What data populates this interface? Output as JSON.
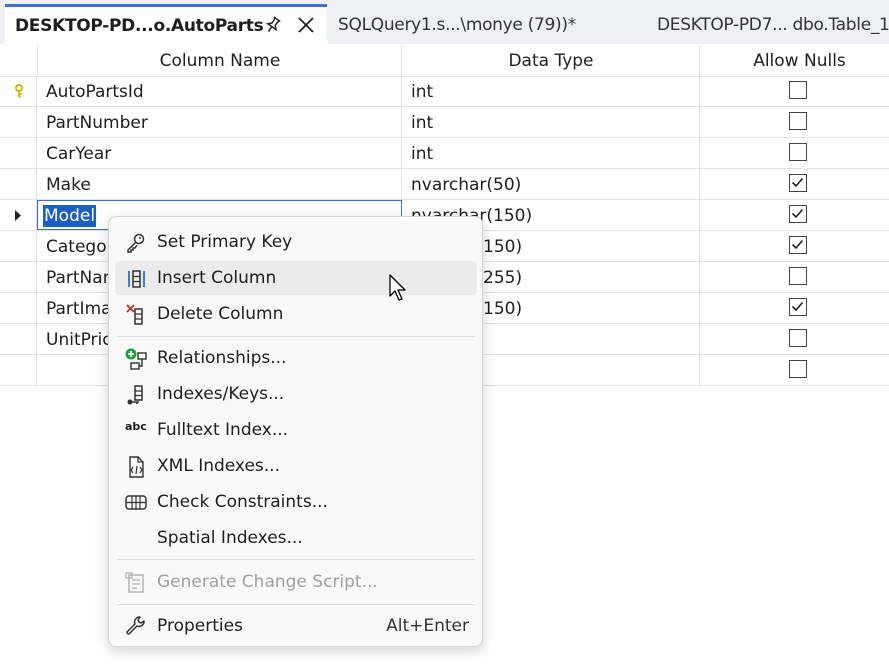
{
  "tabs": [
    {
      "label": "DESKTOP-PD...o.AutoParts",
      "active": true
    },
    {
      "label": "SQLQuery1.s...\\monye (79))*",
      "active": false
    },
    {
      "label": "DESKTOP-PD7... dbo.Table_1",
      "active": false
    }
  ],
  "grid": {
    "headers": {
      "column_name": "Column Name",
      "data_type": "Data Type",
      "allow_nulls": "Allow Nulls"
    },
    "rows": [
      {
        "name": "AutoPartsId",
        "type": "int",
        "nulls": false,
        "key": true
      },
      {
        "name": "PartNumber",
        "type": "int",
        "nulls": false
      },
      {
        "name": "CarYear",
        "type": "int",
        "nulls": false
      },
      {
        "name": "Make",
        "type": "nvarchar(50)",
        "nulls": true
      },
      {
        "name": "Model",
        "type": "nvarchar(150)",
        "nulls": true,
        "editing": true
      },
      {
        "name": "Categor",
        "type": "150)",
        "nulls": true
      },
      {
        "name": "PartNam",
        "type": "255)",
        "nulls": false
      },
      {
        "name": "PartImag",
        "type": "150)",
        "nulls": true
      },
      {
        "name": "UnitPrice",
        "type": "",
        "nulls": false
      },
      {
        "name": "",
        "type": "",
        "nulls": false
      }
    ]
  },
  "context_menu": {
    "items": {
      "set_primary_key": "Set Primary Key",
      "insert_column": "Insert Column",
      "delete_column": "Delete Column",
      "relationships": "Relationships...",
      "indexes_keys": "Indexes/Keys...",
      "fulltext_index": "Fulltext Index...",
      "fulltext_icon_text": "abc",
      "xml_indexes": "XML Indexes...",
      "check_constraints": "Check Constraints...",
      "spatial_indexes": "Spatial Indexes...",
      "generate_change_script": "Generate Change Script...",
      "properties": "Properties",
      "properties_shortcut": "Alt+Enter"
    }
  },
  "colors": {
    "accent": "#3b6fd8",
    "selection": "#1a5fc8",
    "key": "#d8b800",
    "add_green": "#1f9d3a",
    "delete_red": "#d12a2a"
  }
}
